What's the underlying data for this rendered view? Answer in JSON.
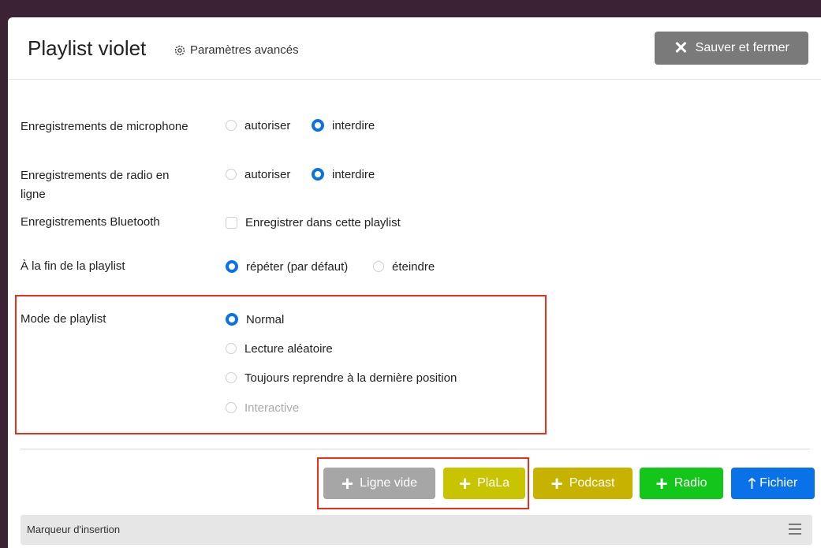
{
  "dialog": {
    "title": "Playlist violet",
    "advanced_label": "Paramètres avancés",
    "save_label": "Sauver et fermer"
  },
  "settings": {
    "mic": {
      "label": "Enregistrements de microphone",
      "opt1": "autoriser",
      "opt2": "interdire",
      "selected": "interdire"
    },
    "radio": {
      "label": "Enregistrements de radio en ligne",
      "opt1": "autoriser",
      "opt2": "interdire",
      "selected": "interdire"
    },
    "bluetooth": {
      "label": "Enregistrements Bluetooth",
      "checkbox_label": "Enregistrer dans cette playlist",
      "checked": false
    },
    "end": {
      "label": "À la fin de la playlist",
      "opt1": "répéter (par défaut)",
      "opt2": "éteindre",
      "selected": "répéter (par défaut)"
    },
    "mode": {
      "label": "Mode de playlist",
      "options": [
        "Normal",
        "Lecture aléatoire",
        "Toujours reprendre à la dernière position",
        "Interactive"
      ],
      "selected": "Normal",
      "disabled": [
        "Interactive"
      ]
    }
  },
  "actions": {
    "empty_line": "Ligne vide",
    "plala": "PlaLa",
    "podcast": "Podcast",
    "radio": "Radio",
    "file": "Fichier"
  },
  "insertion_marker": "Marqueur d'insertion",
  "colors": {
    "accent": "#0a72e8",
    "highlight": "#e8301a",
    "btn_gray": "#a6a6a6",
    "btn_plala": "#c9c400",
    "btn_podcast": "#c7b200",
    "btn_radio": "#13c61a",
    "btn_file": "#0a72e8"
  }
}
